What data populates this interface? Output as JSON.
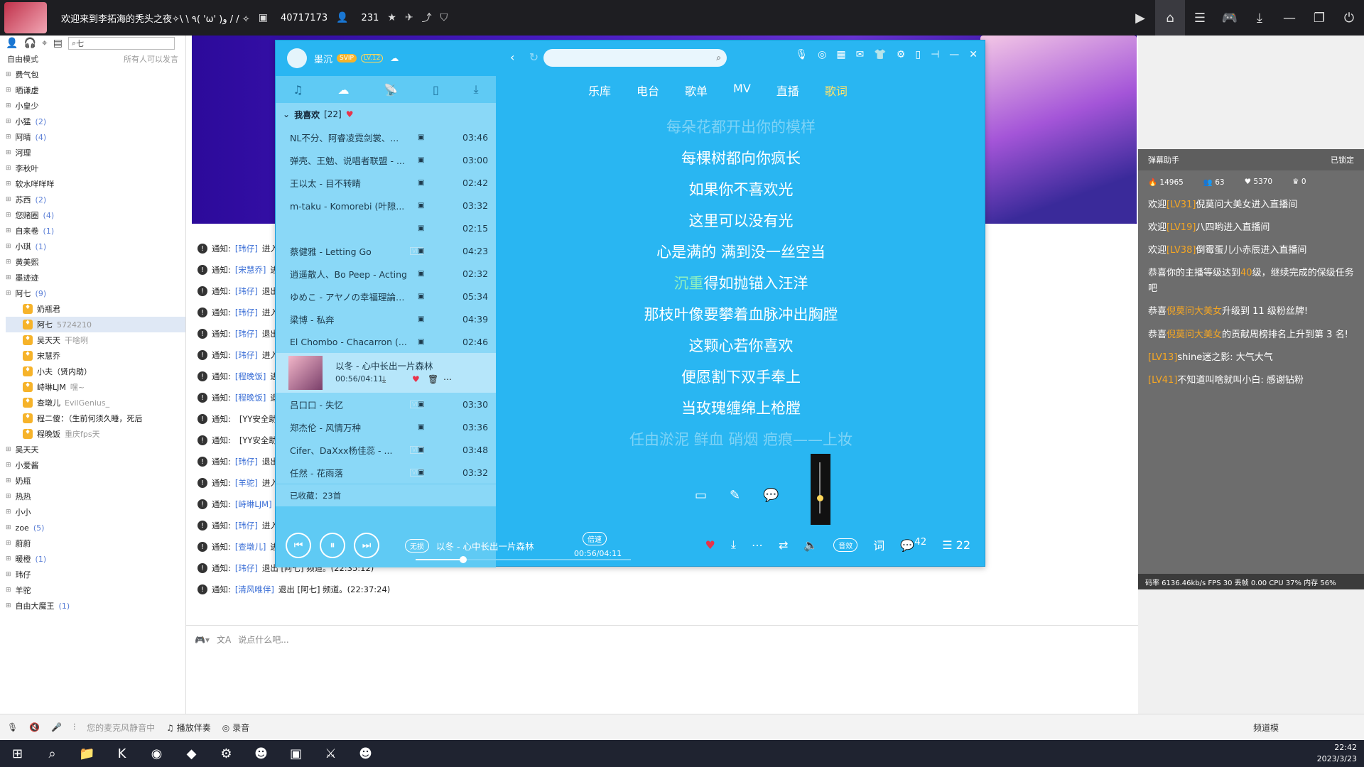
{
  "topbar": {
    "title": "欢迎来到李拓海的秃头之夜✧\\ \\ ٩( 'ω' )و / / ✧",
    "room_id": "40717173",
    "online": "231"
  },
  "left": {
    "search_value": "七",
    "mode": "自由模式",
    "mode_hint": "所有人可以发言",
    "channels": [
      {
        "name": "费气包",
        "count": ""
      },
      {
        "name": "晒谦虚",
        "count": ""
      },
      {
        "name": "小皇少",
        "count": ""
      },
      {
        "name": "小猛",
        "count": "(2)"
      },
      {
        "name": "阿晴",
        "count": "(4)"
      },
      {
        "name": "河理",
        "count": ""
      },
      {
        "name": "李秋叶",
        "count": ""
      },
      {
        "name": "软水咩咩咩",
        "count": ""
      },
      {
        "name": "苏西",
        "count": "(2)"
      },
      {
        "name": "您赌圈",
        "count": "(4)"
      },
      {
        "name": "自来卷",
        "count": "(1)"
      },
      {
        "name": "小琪",
        "count": "(1)"
      },
      {
        "name": "黄美熙",
        "count": ""
      },
      {
        "name": "墨迹迹",
        "count": ""
      },
      {
        "name": "阿七",
        "count": "(9)"
      }
    ],
    "members": [
      {
        "name": "奶瓶君",
        "extra": ""
      },
      {
        "name": "阿七",
        "extra": "5724210"
      },
      {
        "name": "吴天天",
        "extra": "干啥咧"
      },
      {
        "name": "宋慧乔",
        "extra": ""
      },
      {
        "name": "小夫（贤内助）",
        "extra": ""
      },
      {
        "name": "峙琳LJM",
        "extra": "嘿~"
      },
      {
        "name": "查墩儿",
        "extra": "EvilGenius_"
      },
      {
        "name": "程二傻：（生前何须久睡，死后",
        "extra": ""
      },
      {
        "name": "程晚饭",
        "extra": "重庆fps天"
      }
    ],
    "channels2": [
      {
        "name": "吴天天",
        "count": ""
      },
      {
        "name": "小爱酱",
        "count": ""
      },
      {
        "name": "奶瓶",
        "count": ""
      },
      {
        "name": "热热",
        "count": ""
      },
      {
        "name": "小小",
        "count": ""
      },
      {
        "name": "zoe",
        "count": "(5)"
      },
      {
        "name": "蔚蔚",
        "count": ""
      },
      {
        "name": "暖橙",
        "count": "(1)"
      },
      {
        "name": "玮仔",
        "count": ""
      },
      {
        "name": "羊驼",
        "count": ""
      },
      {
        "name": "自由大魔王",
        "count": "(1)"
      }
    ]
  },
  "notices": [
    {
      "label": "通知:",
      "who": "[玮仔]",
      "text": "进入 [阿七] 频道。"
    },
    {
      "label": "通知:",
      "who": "[宋慧乔]",
      "text": "进入 [阿七] 频道。"
    },
    {
      "label": "通知:",
      "who": "[玮仔]",
      "text": "退出 [阿七] 频道。"
    },
    {
      "label": "通知:",
      "who": "[玮仔]",
      "text": "进入 [阿七] 频道。"
    },
    {
      "label": "通知:",
      "who": "[玮仔]",
      "text": "退出 [阿七] 频道。"
    },
    {
      "label": "通知:",
      "who": "[玮仔]",
      "text": "进入 [阿七] 频道。"
    },
    {
      "label": "通知:",
      "who": "[程晚饭]",
      "text": "进入 [阿七] 频道。"
    },
    {
      "label": "通知:",
      "who": "[程晚饭]",
      "text": "退出 [阿七] 频道。"
    },
    {
      "label": "通知:",
      "who": "",
      "text": "[YY安全助手] ..."
    },
    {
      "label": "通知:",
      "who": "",
      "text": "[YY安全助手] ..."
    },
    {
      "label": "通知:",
      "who": "[玮仔]",
      "text": "退出 [阿七] 频道。"
    },
    {
      "label": "通知:",
      "who": "[羊驼]",
      "text": "进入 [阿七] 频道。"
    },
    {
      "label": "通知:",
      "who": "[峙琳LJM]",
      "text": "进入 [阿七] 频道。"
    },
    {
      "label": "通知:",
      "who": "[玮仔]",
      "text": "进入 [阿七] 频道。"
    },
    {
      "label": "通知:",
      "who": "[查墩儿]",
      "text": "进入 [阿七] 频道。(22:35:07)"
    },
    {
      "label": "通知:",
      "who": "[玮仔]",
      "text": "退出 [阿七] 频道。(22:35:12)"
    },
    {
      "label": "通知:",
      "who": "[清风唯伴]",
      "text": "退出 [阿七] 频道。(22:37:24)"
    }
  ],
  "input": {
    "placeholder": "说点什么吧..."
  },
  "rightpanel": {
    "title": "弹幕助手",
    "locked": "已锁定",
    "stats": [
      "14965",
      "63",
      "5370",
      "0"
    ],
    "messages": [
      {
        "pre": "欢迎",
        "lv": "[LV31]",
        "post": "倪莫问大美女进入直播间"
      },
      {
        "pre": "欢迎",
        "lv": "[LV19]",
        "post": "八四哟进入直播间"
      },
      {
        "pre": "欢迎",
        "lv": "[LV38]",
        "post": "倒霉蛋儿小赤辰进入直播间"
      },
      {
        "pre": "恭喜你的主播等级达到",
        "lv": "40",
        "post": "级，继续完成的保级任务吧"
      },
      {
        "pre": "恭喜",
        "lv": "倪莫问大美女",
        "post": "升级到 11 级粉丝牌!"
      },
      {
        "pre": "恭喜",
        "lv": "倪莫问大美女",
        "post": "的贡献周榜排名上升到第 3 名!"
      },
      {
        "pre": "",
        "lv": "[LV13]",
        "post": "shine迷之影: 大气大气"
      },
      {
        "pre": "",
        "lv": "[LV41]",
        "post": "不知道叫啥就叫小白: 感谢钻粉"
      }
    ],
    "footer": "码率 6136.46kb/s FPS 30 丢帧 0.00 CPU 37% 内存 56%"
  },
  "bottombar": {
    "mic_text": "您的麦克风静音中",
    "play_label": "播放伴奏",
    "record_label": "录音",
    "channel_label": "频道模"
  },
  "taskbar": {
    "time": "22:42",
    "date": "2023/3/23"
  },
  "music": {
    "user": "墨沉",
    "svip": "SVIP",
    "level": "LV.12",
    "tabs": [
      "乐库",
      "电台",
      "歌单",
      "MV",
      "直播",
      "歌词"
    ],
    "fav_label": "我喜欢",
    "fav_count": "[22]",
    "songs": [
      {
        "title": "NL不分、阿睿凌霓剑裳、...",
        "dur": "03:46",
        "vip": false,
        "faded": false
      },
      {
        "title": "弹壳、王勉、说唱者联盟 - ...",
        "dur": "03:00",
        "vip": false,
        "faded": false
      },
      {
        "title": "王以太 - 目不转睛",
        "dur": "02:42",
        "vip": false,
        "faded": false
      },
      {
        "title": "m-taku - Komorebi (叶隙...",
        "dur": "03:32",
        "vip": false,
        "faded": false
      },
      {
        "title": "",
        "dur": "02:15",
        "vip": false,
        "faded": true
      },
      {
        "title": "蔡健雅 - Letting Go",
        "dur": "04:23",
        "vip": true,
        "faded": false
      },
      {
        "title": "逍遥散人、Bo Peep - Acting",
        "dur": "02:32",
        "vip": false,
        "faded": false
      },
      {
        "title": "ゆめこ - アヤノの幸福理論 (文...",
        "dur": "05:34",
        "vip": false,
        "faded": false
      },
      {
        "title": "梁博 - 私奔",
        "dur": "04:39",
        "vip": false,
        "faded": false
      },
      {
        "title": "El Chombo - Chacarron (...",
        "dur": "02:46",
        "vip": false,
        "faded": false
      }
    ],
    "playing": {
      "title": "以冬 - 心中长出一片森林",
      "time": "00:56/04:11"
    },
    "songs2": [
      {
        "title": "吕口口 - 失忆",
        "dur": "03:30",
        "vip": true
      },
      {
        "title": "郑杰伦 - 风情万种",
        "dur": "03:36",
        "vip": false
      },
      {
        "title": "Cifer、DaXxx杨佳蕊 - ...",
        "dur": "03:48",
        "vip": true
      },
      {
        "title": "任然 - 花雨落",
        "dur": "03:32",
        "vip": true
      }
    ],
    "collected": "已收藏：23首",
    "lyrics": [
      {
        "text": "每朵花都开出你的模样",
        "cls": "dim"
      },
      {
        "text": "每棵树都向你疯长",
        "cls": ""
      },
      {
        "text": "如果你不喜欢光",
        "cls": ""
      },
      {
        "text": "这里可以没有光",
        "cls": ""
      },
      {
        "text": "心是满的 满到没一丝空当",
        "cls": ""
      },
      {
        "text": "沉重得如抛锚入汪洋",
        "cls": "cur"
      },
      {
        "text": "那枝叶像要攀着血脉冲出胸膛",
        "cls": ""
      },
      {
        "text": "这颗心若你喜欢",
        "cls": ""
      },
      {
        "text": "便愿割下双手奉上",
        "cls": ""
      },
      {
        "text": "当玫瑰缠绵上枪膛",
        "cls": ""
      },
      {
        "text": "任由淤泥 鲜血 硝烟 疤痕——上妆",
        "cls": "dim"
      }
    ],
    "player": {
      "quality": "无损",
      "now": "以冬 - 心中长出一片森林",
      "speed": "倍速",
      "time": "00:56/04:11",
      "effect": "音效",
      "lyric_btn": "词",
      "comment_count": "42",
      "list_count": "22",
      "progress": 0.22,
      "volume": 0.3
    }
  }
}
